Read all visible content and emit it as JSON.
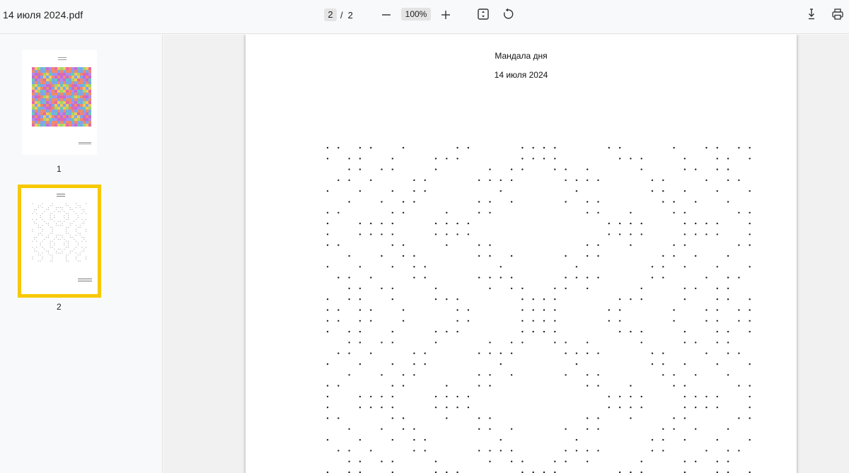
{
  "toolbar": {
    "title": "14 июля 2024.pdf",
    "page_current": "2",
    "page_separator": "/",
    "page_total": "2",
    "zoom": "100%",
    "icons": {
      "zoom_out": "minus-icon",
      "zoom_in": "plus-icon",
      "fit": "fit-page-icon",
      "rotate": "rotate-icon",
      "download": "download-icon",
      "print": "print-icon"
    }
  },
  "sidebar": {
    "thumbnails": [
      {
        "label": "1",
        "selected": false
      },
      {
        "label": "2",
        "selected": true
      }
    ],
    "selected_color": "#f6c900"
  },
  "page": {
    "title": "Мандала дня",
    "date": "14 июля 2024"
  },
  "colors": {
    "background": "#f8f9fa",
    "viewer": "#f1f1f1",
    "dot": "#222222"
  }
}
